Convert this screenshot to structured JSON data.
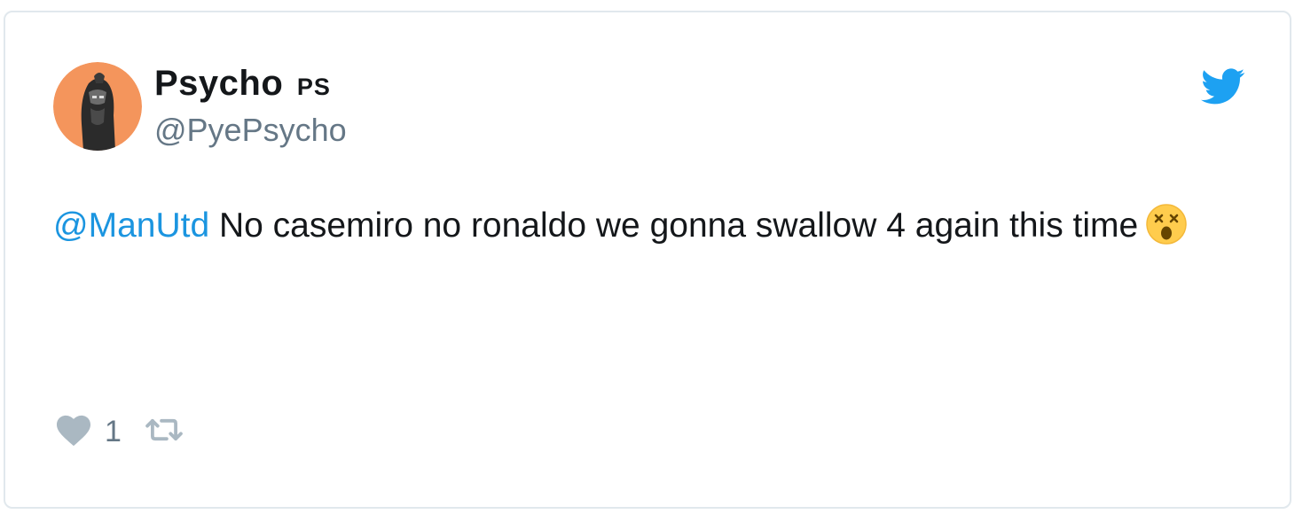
{
  "tweet": {
    "author": {
      "display_name": "Psycho",
      "display_name_suffix": "PS",
      "handle": "@PyePsycho"
    },
    "text": {
      "mention": "@ManUtd",
      "body": " No casemiro no ronaldo we gonna swallow 4 again this time",
      "emoji": "astonished-face"
    },
    "actions": {
      "like_count": "1"
    },
    "colors": {
      "mention": "#1b95e0",
      "twitter_brand": "#1da1f2",
      "muted": "#657786",
      "avatar_bg": "#f4955c"
    },
    "icons": {
      "brand": "twitter-bird-icon",
      "like": "heart-icon",
      "retweet": "retweet-icon"
    }
  }
}
